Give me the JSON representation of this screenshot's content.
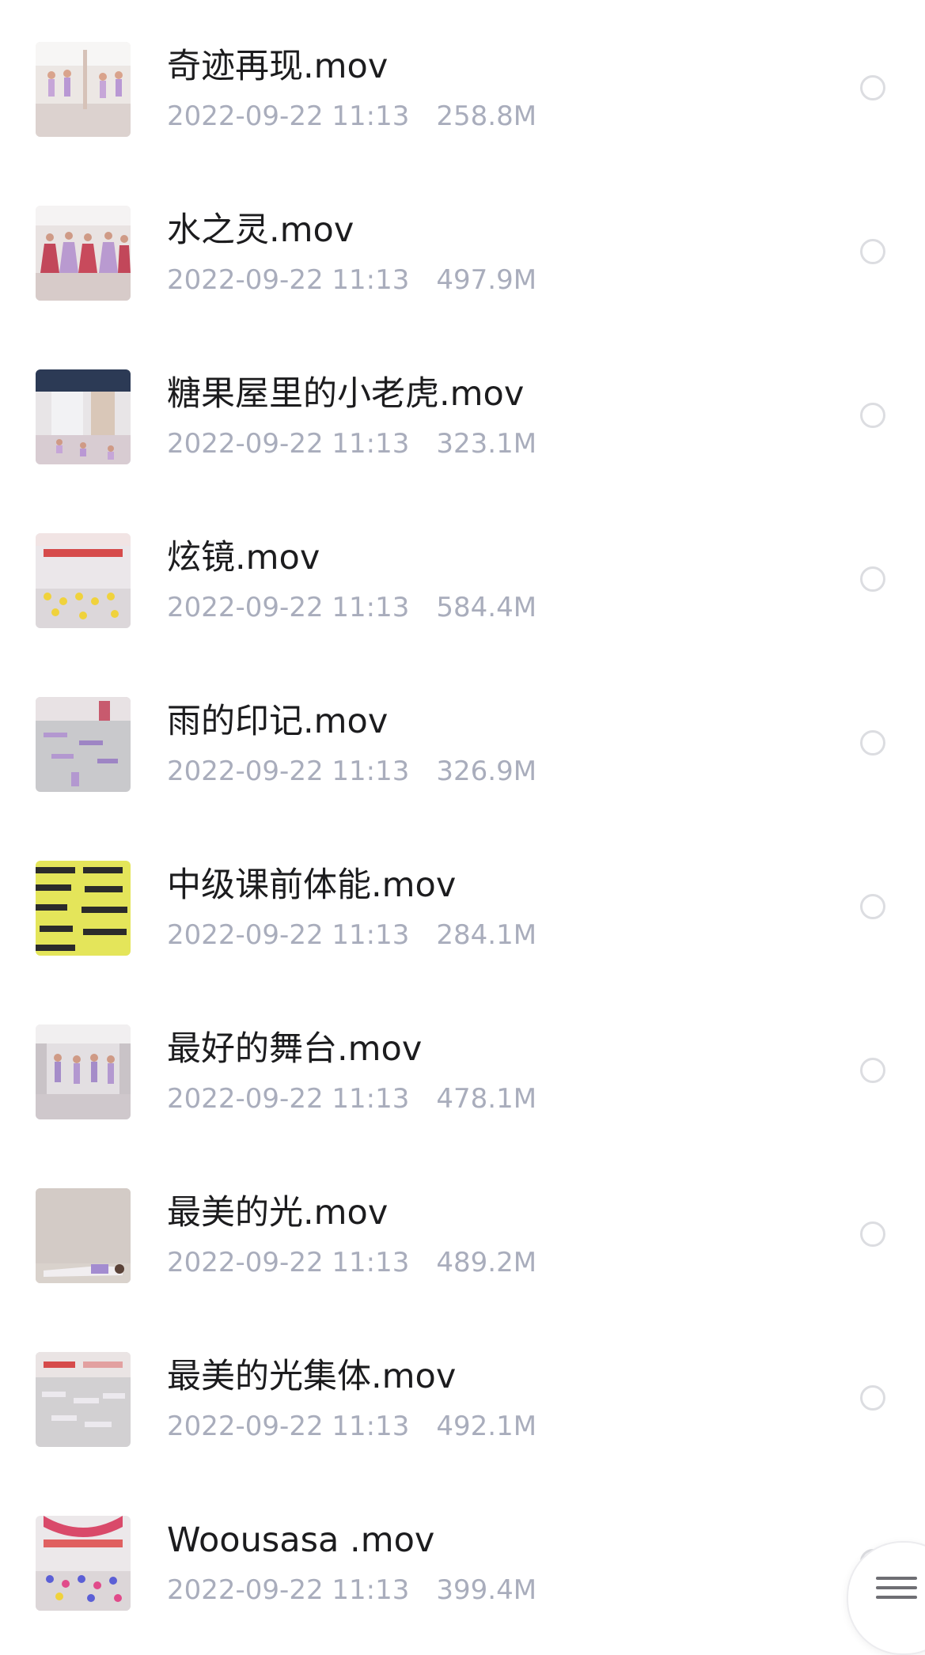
{
  "files": [
    {
      "name": "奇迹再现.mov",
      "date": "2022-09-22 11:13",
      "size": "258.8M",
      "thumb_icon": "dance-studio-thumbnail"
    },
    {
      "name": "水之灵.mov",
      "date": "2022-09-22 11:13",
      "size": "497.9M",
      "thumb_icon": "dance-performance-thumbnail"
    },
    {
      "name": "糖果屋里的小老虎.mov",
      "date": "2022-09-22 11:13",
      "size": "323.1M",
      "thumb_icon": "dance-studio-thumbnail"
    },
    {
      "name": "炫镜.mov",
      "date": "2022-09-22 11:13",
      "size": "584.4M",
      "thumb_icon": "dance-class-thumbnail"
    },
    {
      "name": "雨的印记.mov",
      "date": "2022-09-22 11:13",
      "size": "326.9M",
      "thumb_icon": "floor-exercise-thumbnail"
    },
    {
      "name": "中级课前体能.mov",
      "date": "2022-09-22 11:13",
      "size": "284.1M",
      "thumb_icon": "mat-exercise-thumbnail"
    },
    {
      "name": "最好的舞台.mov",
      "date": "2022-09-22 11:13",
      "size": "478.1M",
      "thumb_icon": "dance-studio-thumbnail"
    },
    {
      "name": "最美的光.mov",
      "date": "2022-09-22 11:13",
      "size": "489.2M",
      "thumb_icon": "solo-floor-thumbnail"
    },
    {
      "name": "最美的光集体.mov",
      "date": "2022-09-22 11:13",
      "size": "492.1M",
      "thumb_icon": "floor-exercise-thumbnail"
    },
    {
      "name": "Woousasa .mov",
      "date": "2022-09-22 11:13",
      "size": "399.4M",
      "thumb_icon": "dance-class-thumbnail"
    }
  ],
  "fab": {
    "icon": "menu-icon"
  },
  "colors": {
    "name_text": "#1c1c1e",
    "meta_text": "#a9adbc",
    "radio_border": "#dcdde1",
    "background": "#ffffff"
  }
}
